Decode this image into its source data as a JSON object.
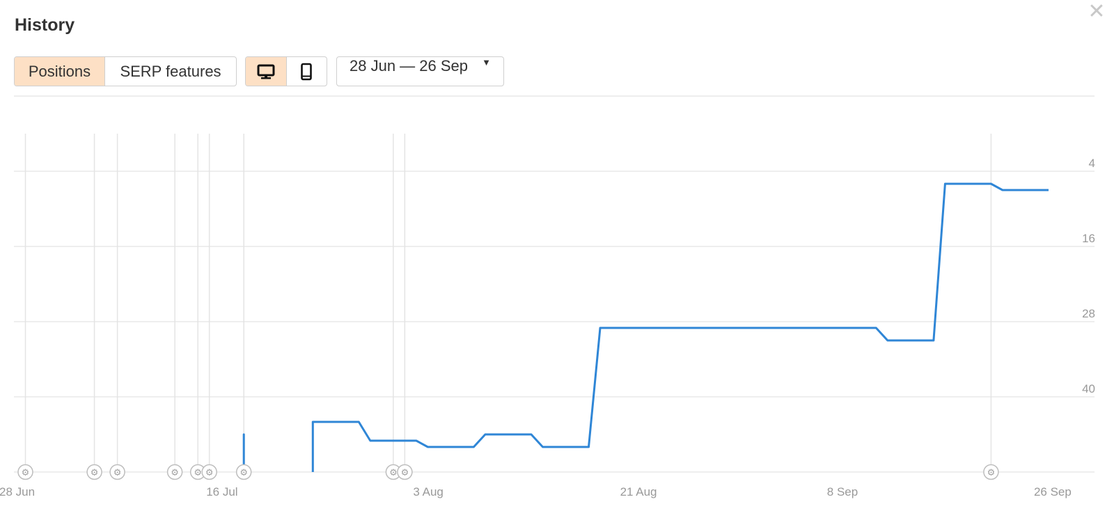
{
  "header": {
    "title": "History",
    "close_icon": "close-icon"
  },
  "toolbar": {
    "tabs": [
      {
        "label": "Positions",
        "active": true
      },
      {
        "label": "SERP features",
        "active": false
      }
    ],
    "devices": [
      {
        "icon": "desktop-icon",
        "active": true
      },
      {
        "icon": "mobile-icon",
        "active": false
      }
    ],
    "date_range": {
      "label": "28 Jun — 26 Sep",
      "icon": "caret-down-icon"
    }
  },
  "colors": {
    "accent_bg": "#fde0c5",
    "line": "#2f86d6",
    "grid": "#e8e8e8"
  },
  "chart_data": {
    "type": "line",
    "title": "",
    "xlabel": "",
    "ylabel": "",
    "x_range": [
      "2019-06-28",
      "2019-09-30"
    ],
    "y_range": [
      52,
      -2
    ],
    "y_axis": "inverted",
    "y_ticks": [
      4,
      16,
      28,
      40
    ],
    "x_ticks": [
      "28 Jun",
      "16 Jul",
      "3 Aug",
      "21 Aug",
      "8 Sep",
      "26 Sep"
    ],
    "x_tick_dates": [
      "2019-06-28",
      "2019-07-16",
      "2019-08-03",
      "2019-08-21",
      "2019-09-08",
      "2019-09-26"
    ],
    "grid": true,
    "annotation_markers": {
      "icon": "gear-icon",
      "dates": [
        "2019-06-29",
        "2019-07-05",
        "2019-07-07",
        "2019-07-12",
        "2019-07-14",
        "2019-07-15",
        "2019-07-18",
        "2019-07-31",
        "2019-08-01",
        "2019-09-21"
      ]
    },
    "series": [
      {
        "segments": [
          [
            [
              "2019-07-18",
              52
            ],
            [
              "2019-07-18",
              46
            ],
            [
              "2019-07-18",
              52
            ]
          ],
          [
            [
              "2019-07-24",
              52
            ],
            [
              "2019-07-24",
              44
            ],
            [
              "2019-07-28",
              44
            ],
            [
              "2019-07-29",
              47
            ],
            [
              "2019-08-02",
              47
            ],
            [
              "2019-08-03",
              48
            ],
            [
              "2019-08-07",
              48
            ],
            [
              "2019-08-08",
              46
            ],
            [
              "2019-08-12",
              46
            ],
            [
              "2019-08-13",
              48
            ],
            [
              "2019-08-17",
              48
            ],
            [
              "2019-08-18",
              29
            ],
            [
              "2019-09-11",
              29
            ],
            [
              "2019-09-12",
              31
            ],
            [
              "2019-09-16",
              31
            ],
            [
              "2019-09-17",
              6
            ],
            [
              "2019-09-21",
              6
            ],
            [
              "2019-09-22",
              7
            ],
            [
              "2019-09-26",
              7
            ]
          ]
        ]
      }
    ]
  }
}
